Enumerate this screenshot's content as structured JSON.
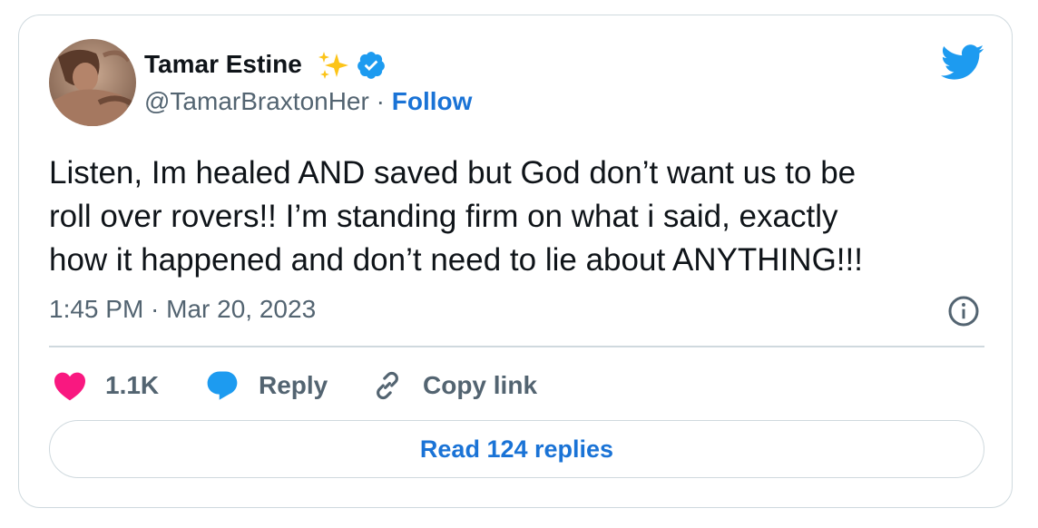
{
  "author": {
    "name": "Tamar Estine",
    "handle": "@TamarBraxtonHer",
    "separator": "·",
    "follow_label": "Follow"
  },
  "tweet": {
    "lines": [
      "Listen, Im healed AND saved but God don’t want us to be",
      "roll over rovers!! I’m standing firm on what i said, exactly",
      "how it happened and don’t need to lie about ANYTHING!!!"
    ],
    "timestamp": "1:45 PM · Mar 20, 2023"
  },
  "actions": {
    "like_count": "1.1K",
    "reply_label": "Reply",
    "copy_link_label": "Copy link"
  },
  "read_replies_label": "Read 124 replies",
  "colors": {
    "accent": "#1d9bf0",
    "link": "#1a73d6",
    "heart": "#f91880",
    "text": "#0f1419",
    "muted": "#536471",
    "border": "#cfd9de",
    "sparkle": "#fcc419"
  },
  "icons": [
    "avatar",
    "sparkles-icon",
    "verified-badge-icon",
    "twitter-bird-icon",
    "info-icon",
    "heart-icon",
    "reply-bubble-icon",
    "link-icon"
  ]
}
